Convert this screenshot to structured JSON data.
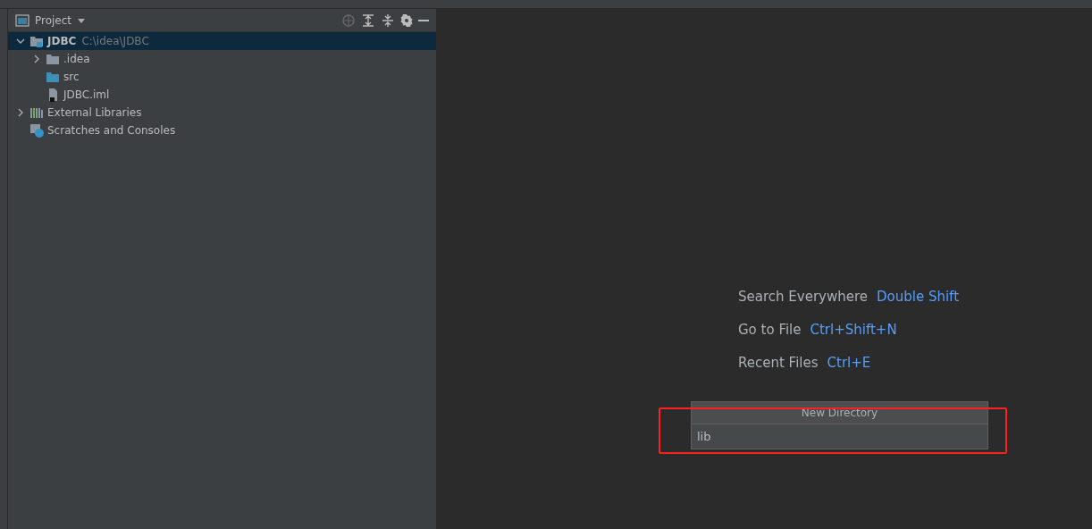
{
  "project_panel": {
    "title": "Project",
    "tree": [
      {
        "name": "JDBC",
        "path": "C:\\idea\\JDBC",
        "kind": "module",
        "expanded": true,
        "selected": true,
        "children": [
          {
            "name": ".idea",
            "kind": "folder",
            "expanded": false,
            "selected": false
          },
          {
            "name": "src",
            "kind": "source",
            "selected": false
          },
          {
            "name": "JDBC.iml",
            "kind": "file",
            "selected": false
          }
        ]
      },
      {
        "name": "External Libraries",
        "kind": "libraries",
        "expanded": false,
        "selected": false
      },
      {
        "name": "Scratches and Consoles",
        "kind": "scratches",
        "selected": false
      }
    ]
  },
  "editor_hints": [
    {
      "label": "Search Everywhere",
      "shortcut": "Double Shift"
    },
    {
      "label": "Go to File",
      "shortcut": "Ctrl+Shift+N"
    },
    {
      "label": "Recent Files",
      "shortcut": "Ctrl+E"
    }
  ],
  "new_directory_popup": {
    "title": "New Directory",
    "value": "lib"
  }
}
